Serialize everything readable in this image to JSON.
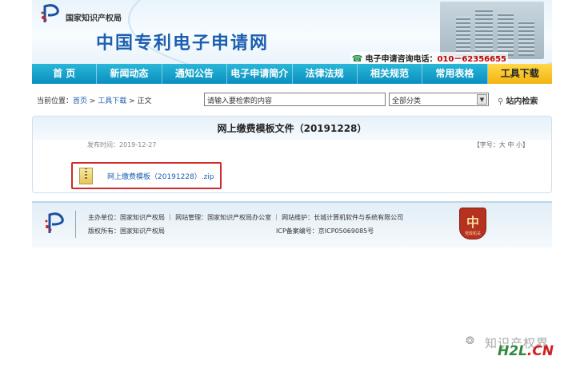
{
  "header": {
    "org_name": "国家知识产权局",
    "site_title": "中国专利电子申请网",
    "hotline_label": "电子申请咨询电话：",
    "hotline_number": "010－62356655"
  },
  "nav": {
    "items": [
      "首 页",
      "新闻动态",
      "通知公告",
      "电子申请简介",
      "法律法规",
      "相关规范",
      "常用表格",
      "工具下载"
    ],
    "active_index": 7
  },
  "breadcrumb": {
    "prefix": "当前位置：",
    "home": "首页",
    "sep": " > ",
    "section": "工具下载",
    "current": "正文"
  },
  "search": {
    "value": "请输入要检索的内容",
    "category": "全部分类",
    "button_label": "站内检索"
  },
  "article": {
    "title": "网上缴费模板文件（20191228）",
    "date_label": "发布时间：2019-12-27",
    "font_size_label": "【字号：大 中 小】",
    "attachment_name": "网上缴费模板（20191228）.zip"
  },
  "footer": {
    "sponsor": "主办单位：国家知识产权局 ｜ 网站管理：国家知识产权局办公室 ｜ 网站维护：长城计算机软件与系统有限公司",
    "copyright": "版权所有：国家知识产权局",
    "icp": "ICP备案编号：京ICP05069085号",
    "badge_text": "党政机关"
  },
  "watermark": {
    "text": "知识产权界",
    "site_prefix": "H2L",
    "site_suffix": ".CN"
  },
  "colors": {
    "nav_blue": "#0a8fbf",
    "nav_active": "#f3b412",
    "title_blue": "#1d5fb0",
    "highlight_red": "#d22a2a"
  }
}
